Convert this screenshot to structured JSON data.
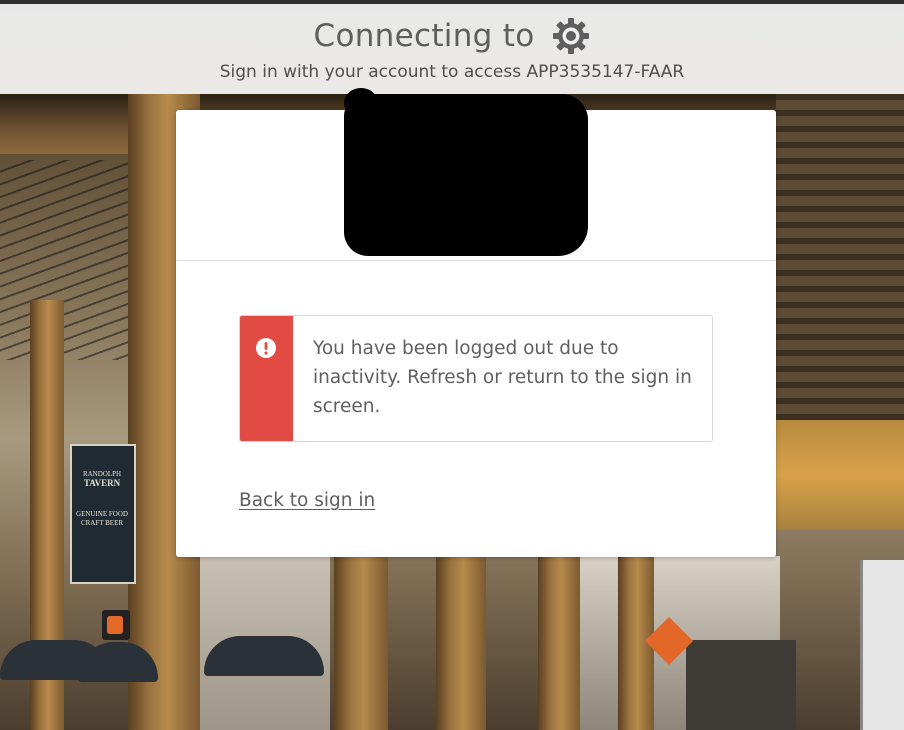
{
  "header": {
    "title": "Connecting to",
    "title_icon": "gear-icon",
    "subtitle": "Sign in with your account to access APP3535147-FAAR"
  },
  "card": {
    "logo": "redacted-logo",
    "alert": {
      "type": "error",
      "icon": "exclamation-circle-icon",
      "accent_color": "#e14b44",
      "message": "You have been logged out due to inactivity. Refresh or return to the sign in screen."
    },
    "back_link": "Back to sign in"
  },
  "background": {
    "sign": {
      "line1": "RANDOLPH",
      "line2": "TAVERN",
      "line3": "GENUINE FOOD",
      "line4": "CRAFT BEER"
    }
  }
}
